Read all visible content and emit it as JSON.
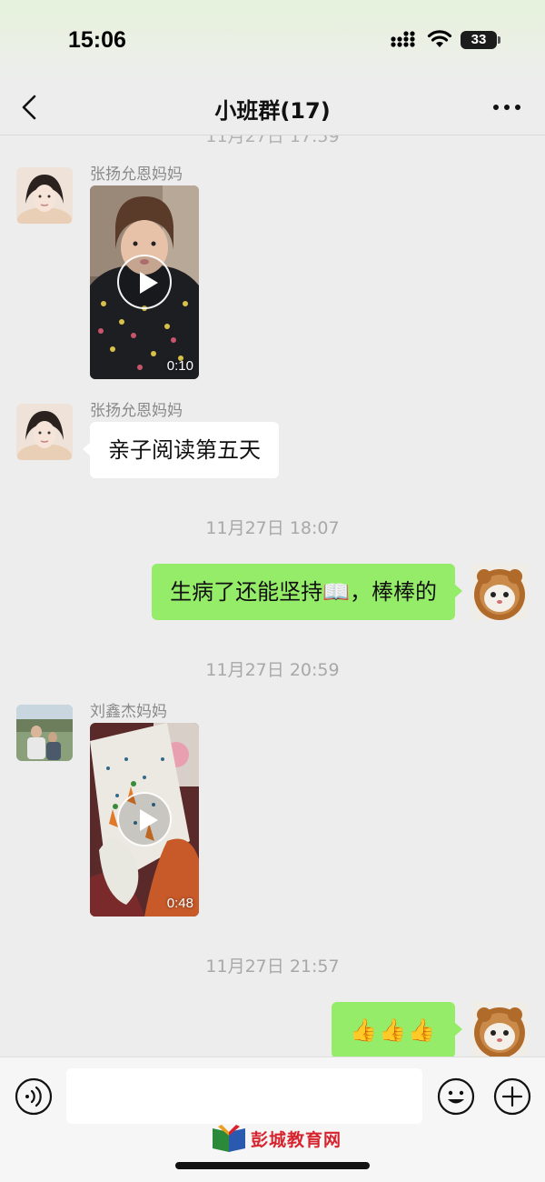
{
  "status_bar": {
    "time": "15:06",
    "battery": "33",
    "icons": [
      "signal-icon",
      "wifi-icon",
      "battery-icon"
    ]
  },
  "header": {
    "title": "小班群(17)",
    "back_icon": "chevron-left-icon",
    "more_icon": "more-dots-icon"
  },
  "messages": [
    {
      "kind": "timestamp-partial",
      "text": "11月27日 17:59"
    },
    {
      "kind": "video",
      "side": "left",
      "sender": "张扬允恩妈妈",
      "duration": "0:10"
    },
    {
      "kind": "text",
      "side": "left",
      "sender": "张扬允恩妈妈",
      "text": "亲子阅读第五天"
    },
    {
      "kind": "timestamp",
      "text": "11月27日 18:07"
    },
    {
      "kind": "text",
      "side": "right",
      "text": "生病了还能坚持📖，棒棒的"
    },
    {
      "kind": "timestamp",
      "text": "11月27日 20:59"
    },
    {
      "kind": "video",
      "side": "left",
      "sender": "刘鑫杰妈妈",
      "duration": "0:48"
    },
    {
      "kind": "timestamp",
      "text": "11月27日 21:57"
    },
    {
      "kind": "text",
      "side": "right",
      "text": "👍👍👍"
    }
  ],
  "input_bar": {
    "placeholder": "",
    "voice_icon": "voice-icon",
    "emoji_icon": "emoji-icon",
    "plus_icon": "plus-icon"
  },
  "watermark": {
    "text": "彭城教育网"
  },
  "colors": {
    "background": "#ededed",
    "self_bubble": "#95ec69",
    "other_bubble": "#ffffff",
    "watermark": "#d7232d"
  }
}
